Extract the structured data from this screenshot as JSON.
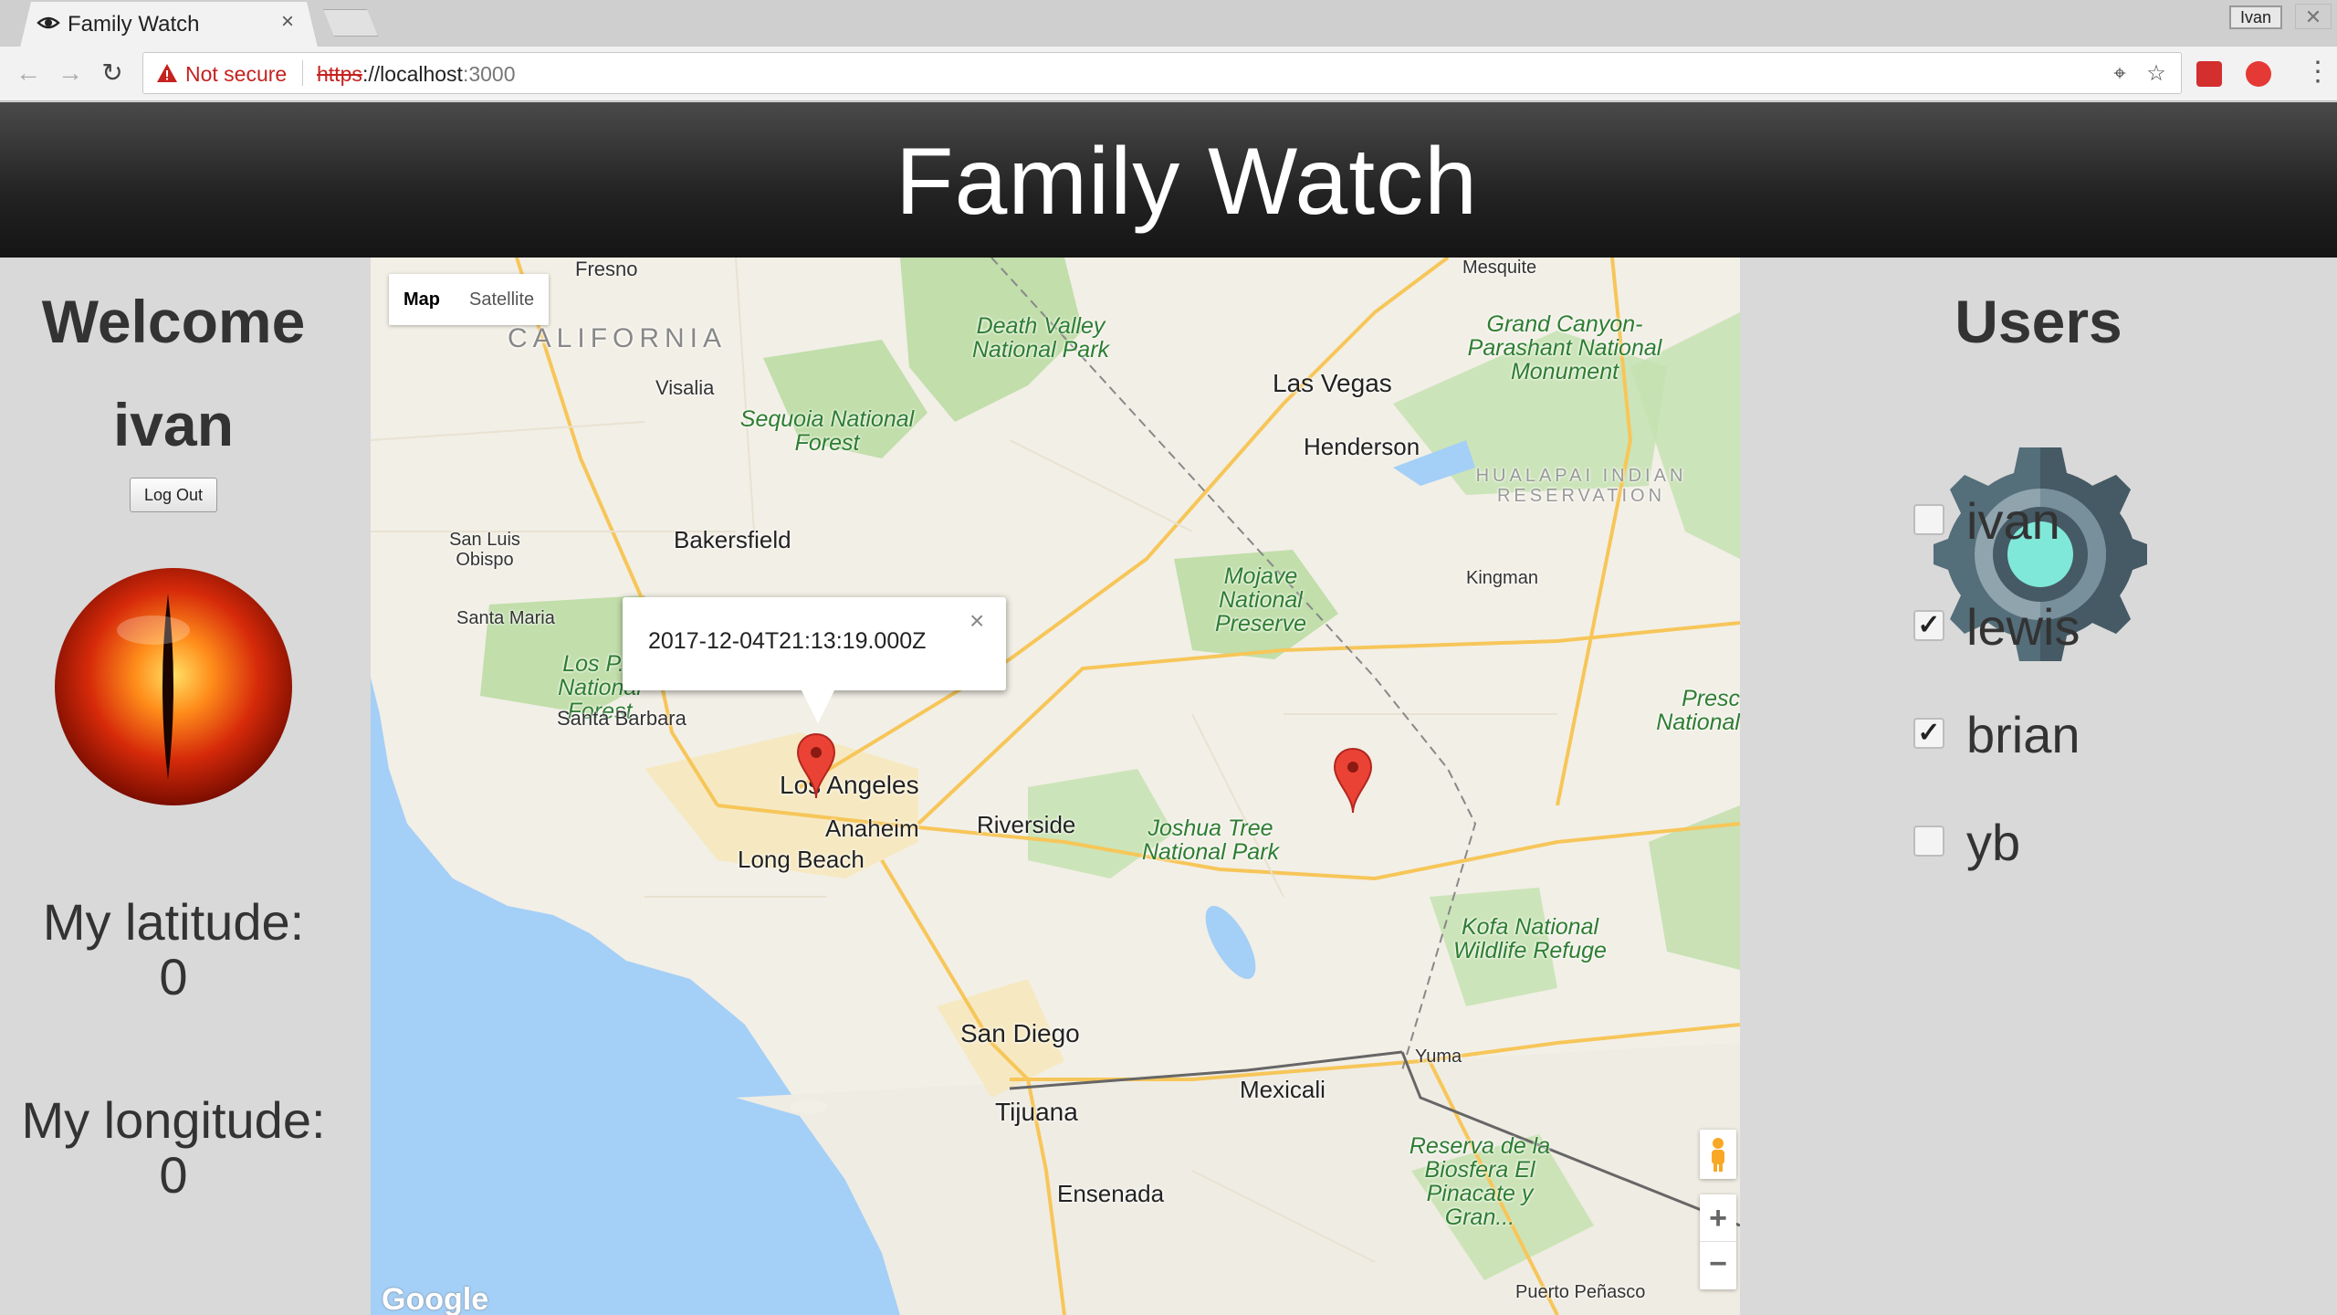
{
  "browser": {
    "tab_title": "Family Watch",
    "tab_close": "×",
    "profile_name": "Ivan",
    "security_label": "Not secure",
    "url_scheme": "https",
    "url_host": "://localhost",
    "url_port": ":3000"
  },
  "header": {
    "title": "Family Watch"
  },
  "sidebar": {
    "welcome": "Welcome",
    "username": "ivan",
    "logout_label": "Log Out",
    "latitude_label": "My latitude:",
    "latitude_value": "0",
    "longitude_label": "My longitude:",
    "longitude_value": "0"
  },
  "map": {
    "type_map": "Map",
    "type_satellite": "Satellite",
    "info_timestamp": "2017-12-04T21:13:19.000Z",
    "info_close": "×",
    "zoom_in": "+",
    "zoom_out": "−",
    "labels": {
      "fresno": "Fresno",
      "california": "CALIFORNIA",
      "visalia": "Visalia",
      "sequoia": "Sequoia National Forest",
      "death_valley": "Death Valley National Park",
      "las_vegas": "Las Vegas",
      "henderson": "Henderson",
      "mesquite": "Mesquite",
      "grand_canyon": "Grand Canyon-Parashant National Monument",
      "hualapai": "HUALAPAI INDIAN RESERVATION",
      "kingman": "Kingman",
      "san_luis": "San Luis Obispo",
      "bakersfield": "Bakersfield",
      "santa_maria": "Santa Maria",
      "los_padres": "Los P... National Forest",
      "santa_barbara": "Santa Barbara",
      "mojave": "Mojave National Preserve",
      "los_angeles": "Los Angeles",
      "anaheim": "Anaheim",
      "riverside": "Riverside",
      "long_beach": "Long Beach",
      "joshua_tree": "Joshua Tree National Park",
      "kofa": "Kofa National Wildlife Refuge",
      "prescott": "Presc National",
      "san_diego": "San Diego",
      "tijuana": "Tijuana",
      "mexicali": "Mexicali",
      "yuma": "Yuma",
      "reserva": "Reserva de la Biosfera El Pinacate y Gran...",
      "ensenada": "Ensenada",
      "puerto": "Puerto Peñasco",
      "google": "Google"
    }
  },
  "users": {
    "title": "Users",
    "list": [
      {
        "name": "ivan",
        "checked": false,
        "mark": ""
      },
      {
        "name": "lewis",
        "checked": true,
        "mark": "✓"
      },
      {
        "name": "brian",
        "checked": true,
        "mark": "✓"
      },
      {
        "name": "yb",
        "checked": false,
        "mark": ""
      }
    ]
  },
  "colors": {
    "header_bg": "#222222",
    "panel_bg": "#d9d9d9",
    "marker_red": "#ea4335",
    "gear_teal": "#80e8d8",
    "gear_slate": "#546e7a"
  }
}
